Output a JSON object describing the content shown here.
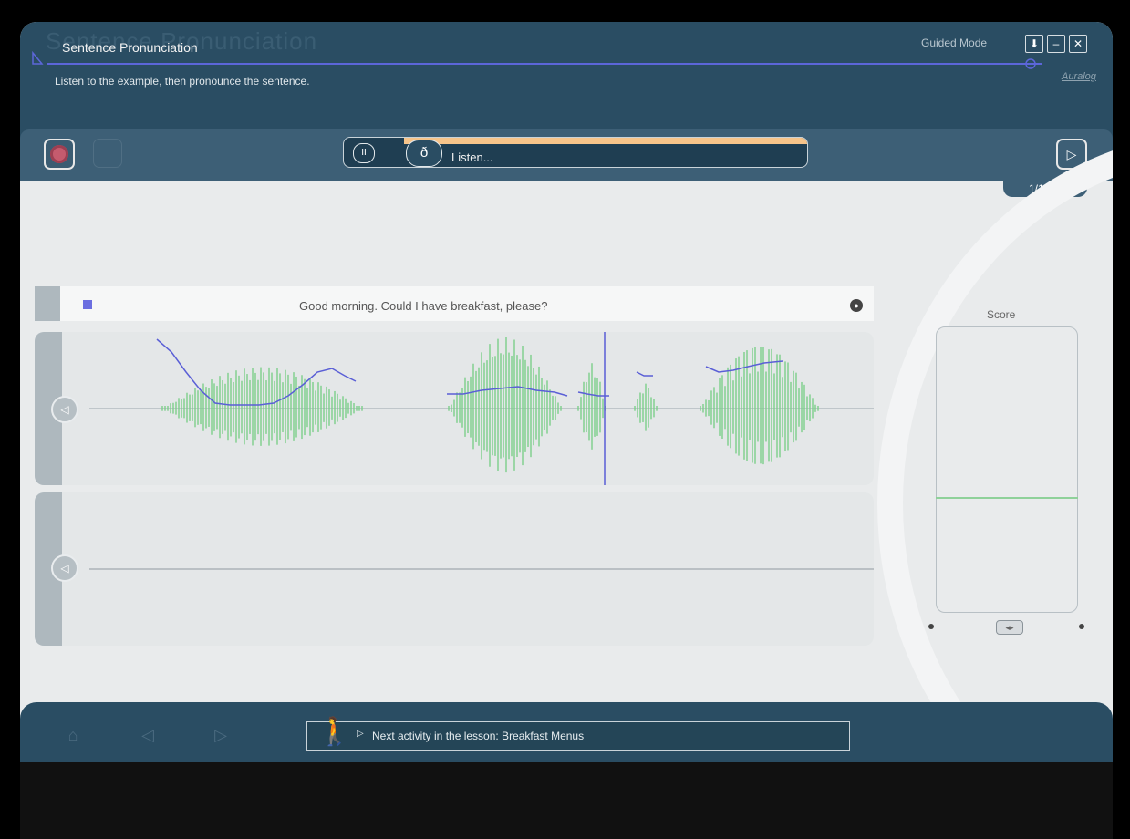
{
  "header": {
    "background_title": "Sentence Pronunciation",
    "title": "Sentence Pronunciation",
    "subtitle": "Listen to the example, then pronounce the sentence.",
    "mode_label": "Guided Mode",
    "brand": "Auralog",
    "window_buttons": [
      {
        "name": "download-icon",
        "glyph": "⬇"
      },
      {
        "name": "minimize-icon",
        "glyph": "–"
      },
      {
        "name": "close-icon",
        "glyph": "✕"
      }
    ]
  },
  "toolbar": {
    "status_text": "Listen...",
    "progress_fraction": 0.87,
    "counter": "1/15",
    "icons": [
      "record-icon",
      "pause-icon",
      "ear-icon",
      "next-icon"
    ]
  },
  "exercise": {
    "sentence": "Good morning. Could I have breakfast, please?",
    "score_label": "Score",
    "score_level": 0.4,
    "slider_position": 0.5
  },
  "footer": {
    "next_activity_text": "Next activity in the lesson: Breakfast Menus",
    "icons": [
      "home-icon",
      "back-icon",
      "forward-icon",
      "walker-icon"
    ]
  },
  "colors": {
    "header_bg": "#2a4d63",
    "progress": "#f7c48a",
    "waveform": "#7ccf8a",
    "pitch_curve": "#5a5fd6",
    "record": "#c55b6e"
  }
}
